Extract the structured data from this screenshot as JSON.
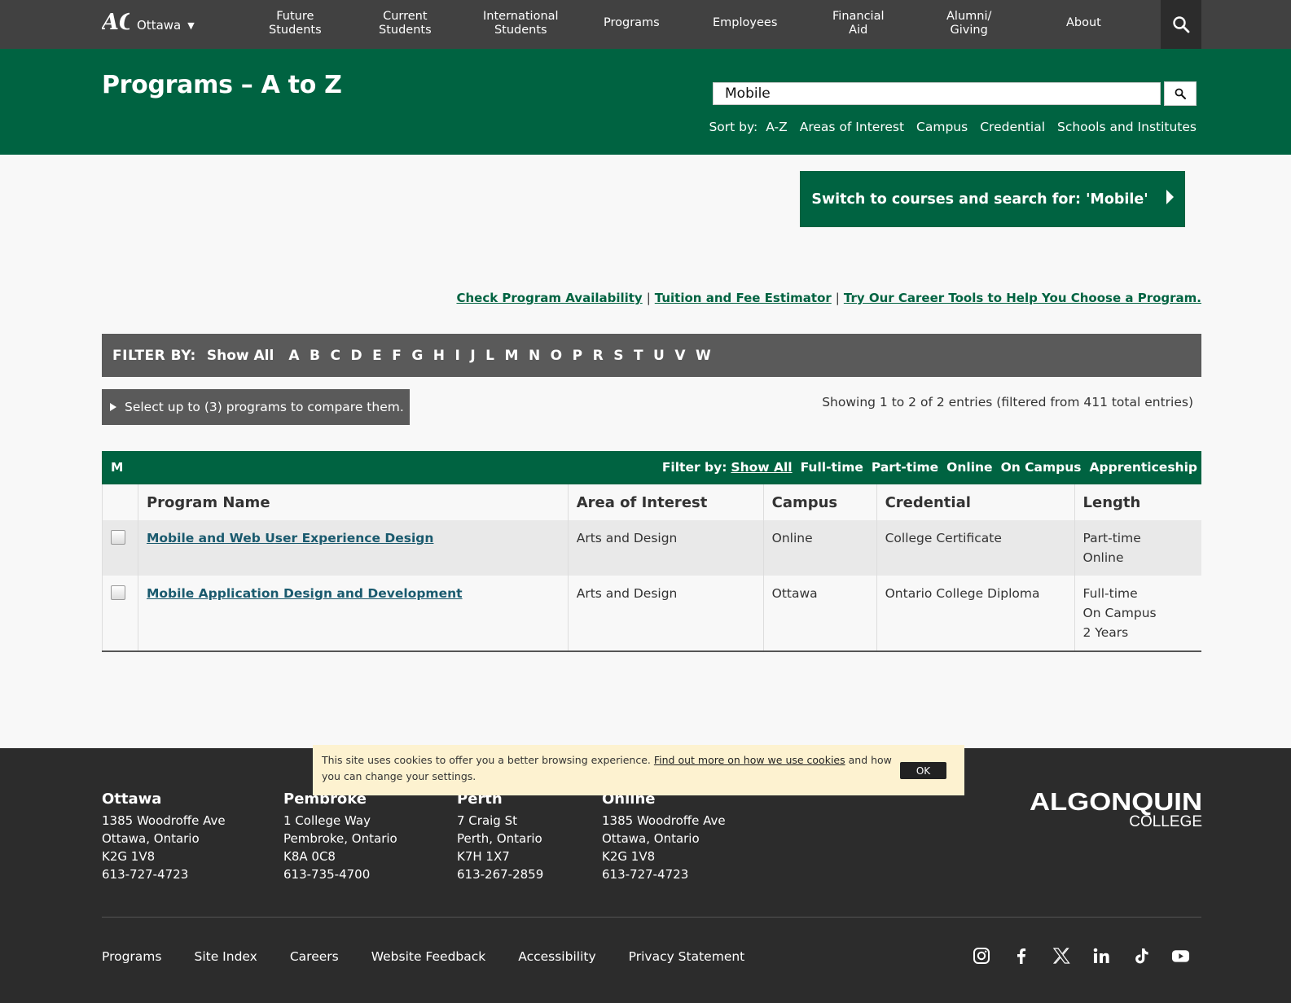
{
  "topnav": {
    "campus": "Ottawa",
    "items": [
      {
        "label": "Future\nStudents"
      },
      {
        "label": "Current\nStudents"
      },
      {
        "label": "International\nStudents"
      },
      {
        "label": "Programs"
      },
      {
        "label": "Employees"
      },
      {
        "label": "Financial\nAid"
      },
      {
        "label": "Alumni/\nGiving"
      },
      {
        "label": "About"
      }
    ]
  },
  "hero": {
    "title": "Programs – A to Z",
    "search_value": "Mobile",
    "sort_label": "Sort by:",
    "sort_options": [
      "A-Z",
      "Areas of Interest",
      "Campus",
      "Credential",
      "Schools and Institutes"
    ]
  },
  "switch_button": "Switch to courses and search for: 'Mobile'",
  "links": {
    "availability": "Check Program Availability",
    "tuition": "Tuition and Fee Estimator",
    "career": "Try Our Career Tools to Help You Choose a Program.",
    "separator": "|"
  },
  "filter_bar": {
    "label": "FILTER BY:",
    "show_all": "Show All",
    "letters": [
      "A",
      "B",
      "C",
      "D",
      "E",
      "F",
      "G",
      "H",
      "I",
      "J",
      "L",
      "M",
      "N",
      "O",
      "P",
      "R",
      "S",
      "T",
      "U",
      "V",
      "W"
    ]
  },
  "compare": "Select up to (3) programs to compare them.",
  "showing": "Showing 1 to 2 of 2 entries (filtered from 411 total entries)",
  "table": {
    "group_letter": "M",
    "filter_label": "Filter by:",
    "filter_show_all": "Show All",
    "filter_options": [
      "Full-time",
      "Part-time",
      "Online",
      "On Campus",
      "Apprenticeship"
    ],
    "headers": [
      "Program Name",
      "Area of Interest",
      "Campus",
      "Credential",
      "Length"
    ],
    "rows": [
      {
        "name": "Mobile and Web User Experience Design",
        "area": "Arts and Design",
        "campus": "Online",
        "credential": "College Certificate",
        "length": [
          "Part-time",
          "Online"
        ]
      },
      {
        "name": "Mobile Application Design and Development",
        "area": "Arts and Design",
        "campus": "Ottawa",
        "credential": "Ontario College Diploma",
        "length": [
          "Full-time",
          "On Campus",
          "2 Years"
        ]
      }
    ]
  },
  "cookie": {
    "text_before": "This site uses cookies to offer you a better browsing experience.",
    "link": "Find out more on how we use cookies",
    "text_after": "and how you can change your settings.",
    "ok": "OK"
  },
  "footer": {
    "campuses": [
      {
        "name": "Ottawa",
        "lines": [
          "1385 Woodroffe Ave",
          "Ottawa, Ontario",
          "K2G 1V8",
          "613-727-4723"
        ]
      },
      {
        "name": "Pembroke",
        "lines": [
          "1 College Way",
          "Pembroke, Ontario",
          "K8A 0C8",
          "613-735-4700"
        ]
      },
      {
        "name": "Perth",
        "lines": [
          "7 Craig St",
          "Perth, Ontario",
          "K7H 1X7",
          "613-267-2859"
        ]
      },
      {
        "name": "Online",
        "lines": [
          "1385 Woodroffe Ave",
          "Ottawa, Ontario",
          "K2G 1V8",
          "613-727-4723"
        ]
      }
    ],
    "logo_text": [
      "ALGONQUIN",
      "COLLEGE"
    ],
    "links": [
      "Programs",
      "Site Index",
      "Careers",
      "Website Feedback",
      "Accessibility",
      "Privacy Statement"
    ],
    "social": [
      "instagram-icon",
      "facebook-icon",
      "x-icon",
      "linkedin-icon",
      "tiktok-icon",
      "youtube-icon"
    ]
  },
  "colors": {
    "brand_green": "#006341",
    "nav_dark": "#414141",
    "footer_dark": "#2c2c2c",
    "link_teal": "#1a5a6e"
  }
}
